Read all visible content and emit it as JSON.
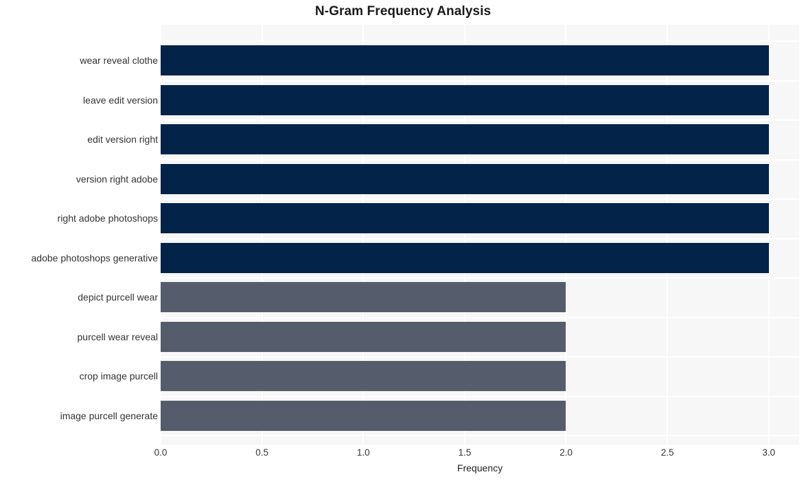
{
  "chart_data": {
    "type": "bar",
    "orientation": "horizontal",
    "title": "N-Gram Frequency Analysis",
    "xlabel": "Frequency",
    "ylabel": "",
    "categories": [
      "wear reveal clothe",
      "leave edit version",
      "edit version right",
      "version right adobe",
      "right adobe photoshops",
      "adobe photoshops generative",
      "depict purcell wear",
      "purcell wear reveal",
      "crop image purcell",
      "image purcell generate"
    ],
    "values": [
      3,
      3,
      3,
      3,
      3,
      3,
      2,
      2,
      2,
      2
    ],
    "bar_colors": [
      "#042349",
      "#042349",
      "#042349",
      "#042349",
      "#042349",
      "#042349",
      "#555c6b",
      "#555c6b",
      "#555c6b",
      "#555c6b"
    ],
    "xlim": [
      0,
      3.15
    ],
    "xticks": [
      0.0,
      0.5,
      1.0,
      1.5,
      2.0,
      2.5,
      3.0
    ],
    "xtick_labels": [
      "0.0",
      "0.5",
      "1.0",
      "1.5",
      "2.0",
      "2.5",
      "3.0"
    ],
    "grid": true,
    "grid_color": "#ffffff",
    "plot_background": "#f7f7f7",
    "figure_background": "#ffffff",
    "legend": null
  }
}
